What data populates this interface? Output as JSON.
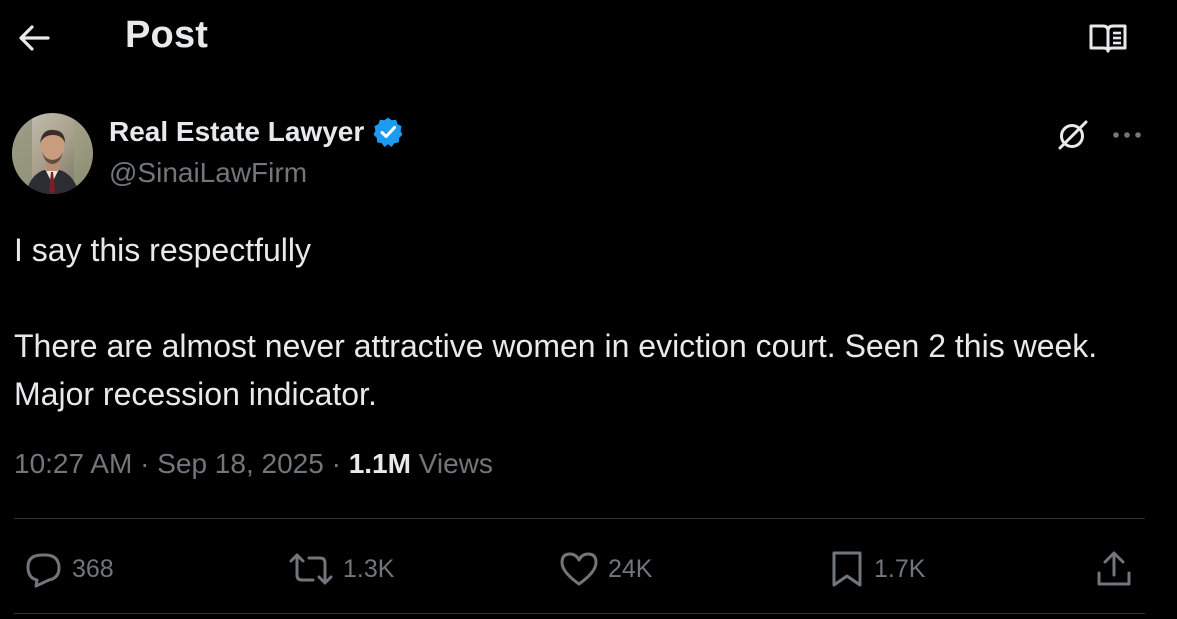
{
  "header": {
    "title": "Post",
    "back_icon": "arrow-left-icon",
    "reader_icon": "reader-book-icon"
  },
  "author": {
    "name": "Real Estate Lawyer",
    "handle": "@SinaiLawFirm",
    "verified": true,
    "verified_color": "#1d9bf0"
  },
  "post": {
    "paragraph_1": "I say this respectfully",
    "paragraph_2": "There are almost never attractive women in eviction court. Seen 2 this week. Major recession indicator."
  },
  "meta": {
    "time": "10:27 AM",
    "separator_1": "·",
    "date": "Sep 18, 2025",
    "separator_2": "·",
    "views_count": "1.1M",
    "views_label": "Views"
  },
  "actions": {
    "replies": "368",
    "reposts": "1.3K",
    "likes": "24K",
    "bookmarks": "1.7K"
  },
  "colors": {
    "background": "#000000",
    "text_primary": "#e7e9ea",
    "text_secondary": "#71767b",
    "divider": "#2f3336"
  }
}
